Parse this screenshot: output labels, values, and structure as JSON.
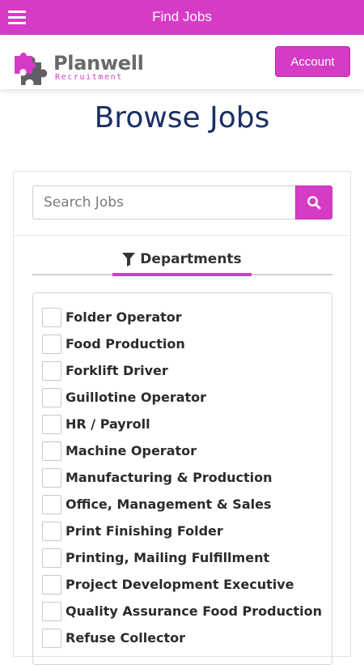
{
  "topbar": {
    "title": "Find Jobs",
    "color": "#d63bc6"
  },
  "header": {
    "logo": {
      "name": "Planwell",
      "sub": "Recruitment"
    },
    "account_label": "Account"
  },
  "main": {
    "title": "Browse Jobs",
    "search": {
      "placeholder": "Search Jobs",
      "value": ""
    },
    "tab": {
      "label": "Departments",
      "icon": "filter-icon"
    },
    "departments": [
      "Folder Operator",
      "Food Production",
      "Forklift Driver",
      "Guillotine Operator",
      "HR / Payroll",
      "Machine Operator",
      "Manufacturing & Production",
      "Office, Management & Sales",
      "Print Finishing Folder",
      "Printing, Mailing Fulfillment",
      "Project Development Executive",
      "Quality Assurance Food Production",
      "Refuse Collector"
    ]
  },
  "colors": {
    "accent": "#d63bc6",
    "title": "#1a2f66",
    "logo_grey": "#6a6a6a"
  }
}
